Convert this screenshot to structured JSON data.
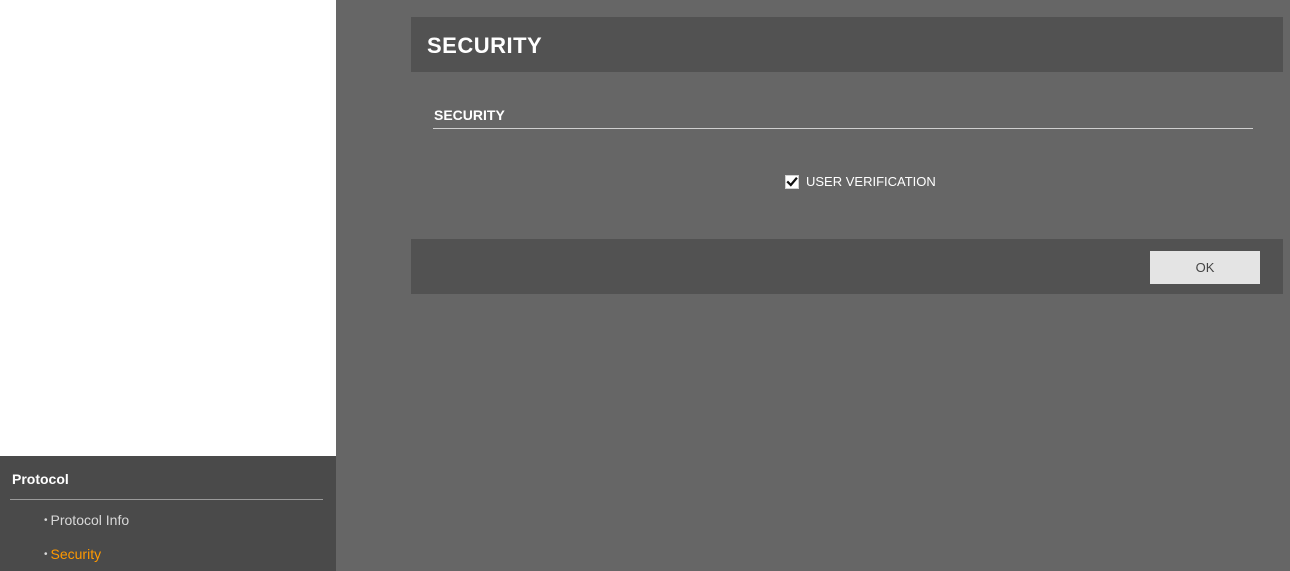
{
  "sidebar": {
    "header": "Protocol",
    "items": [
      {
        "label": "Protocol Info",
        "active": false
      },
      {
        "label": "Security",
        "active": true
      }
    ],
    "bullet": "•"
  },
  "main": {
    "title": "SECURITY",
    "section_title": "SECURITY",
    "user_verification": {
      "label": "USER VERIFICATION",
      "checked": true
    },
    "ok_label": "OK"
  },
  "colors": {
    "active_item": "#ff9900",
    "main_bg": "#666666",
    "bar_bg": "#525252",
    "sidebar_bg": "#4a4a4a"
  }
}
